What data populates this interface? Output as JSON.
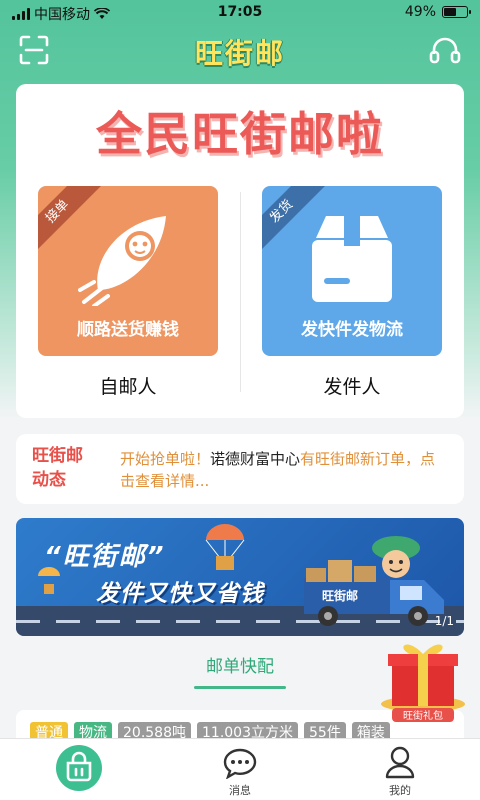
{
  "status_bar": {
    "carrier": "中国移动",
    "time": "17:05",
    "battery": "49%",
    "battery_level": 0.49
  },
  "nav": {
    "title": "旺街邮"
  },
  "banner": {
    "title": "全民旺街邮啦"
  },
  "roles": [
    {
      "ribbon": "接单",
      "caption": "顺路送货赚钱",
      "label": "自邮人"
    },
    {
      "ribbon": "发货",
      "caption": "发快件发物流",
      "label": "发件人"
    }
  ],
  "news": {
    "logo_line1": "旺街邮",
    "logo_line2": "动态",
    "prefix": "开始抢单啦！",
    "name": "诺德财富中心",
    "suffix": "有旺街邮新订单，点击查看详情..."
  },
  "promo": {
    "title": "“旺街邮”",
    "subtitle": "发件又快又省钱",
    "truck_text": "旺街邮",
    "pager": "1/1"
  },
  "section": {
    "title": "邮单快配"
  },
  "gift": {
    "label": "旺街礼包"
  },
  "order": {
    "tags": [
      "普通",
      "物流",
      "20.588吨",
      "11.003立方米",
      "55件",
      "箱装"
    ]
  },
  "tabbar": {
    "items": [
      {
        "label": ""
      },
      {
        "label": "消息"
      },
      {
        "label": "我的"
      }
    ]
  }
}
